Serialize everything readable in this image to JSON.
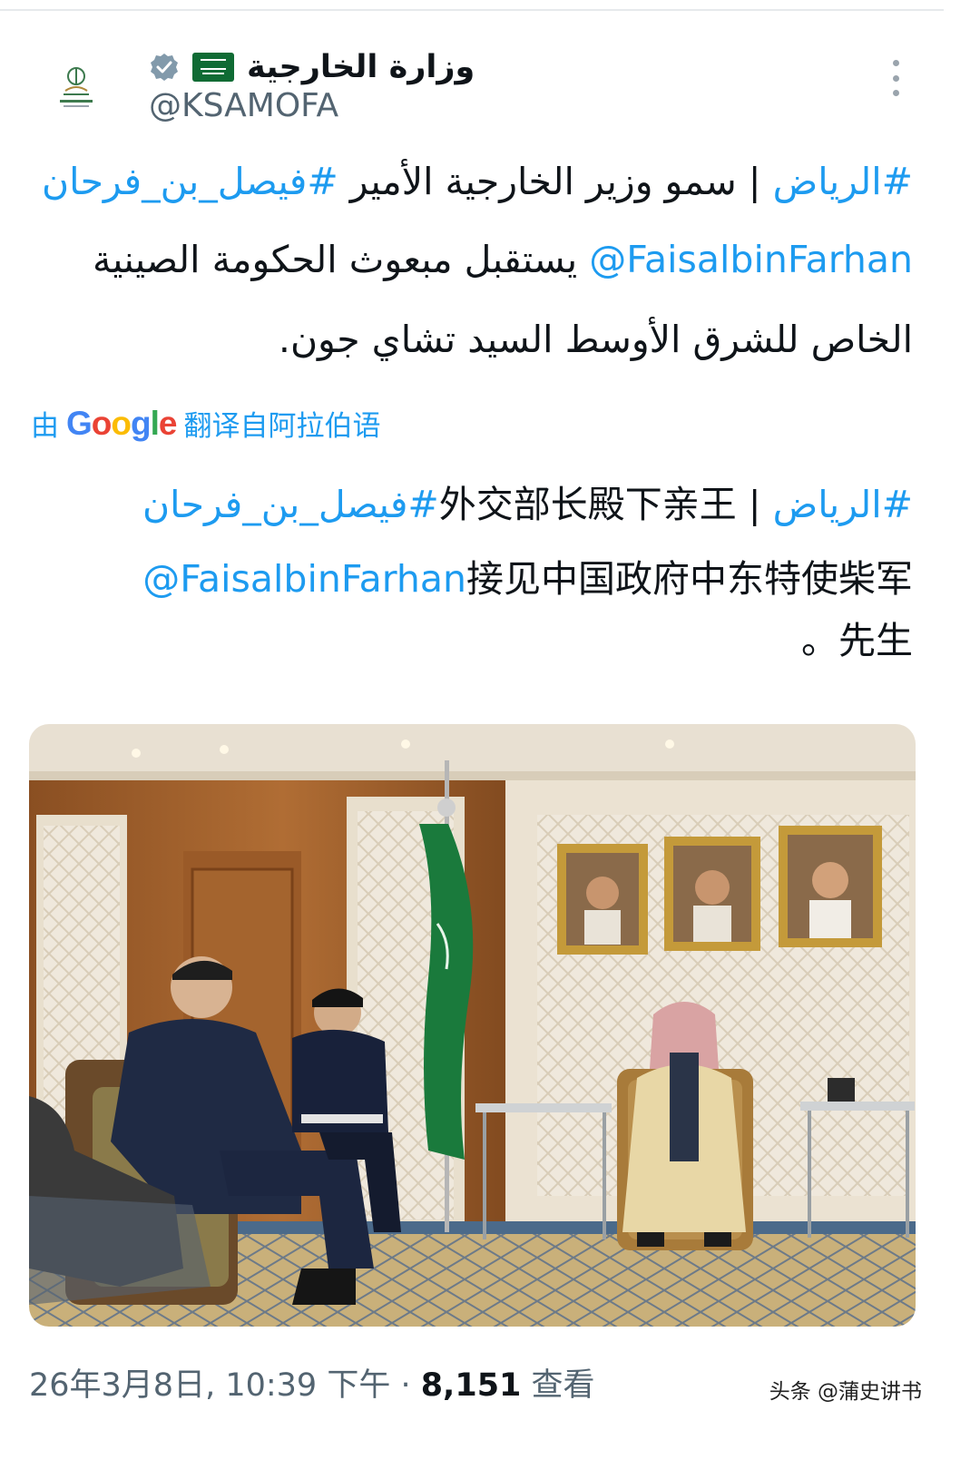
{
  "account": {
    "display_name": "وزارة الخارجية",
    "handle": "@KSAMOFA",
    "verified_icon": "verified-badge-icon",
    "flag_icon": "saudi-flag-icon"
  },
  "tweet_original": {
    "line1_hashtag1": "#الرياض",
    "line1_text": " | سمو وزير الخارجية الأمير ",
    "line1_hashtag2": "#فيصل_بن_فرحان",
    "line2_mention": "@FaisalbinFarhan",
    "line2_text": " يستقبل مبعوث الحكومة الصينية",
    "line3_text": "الخاص للشرق الأوسط السيد تشاي جون."
  },
  "translation_label": {
    "prefix": "由",
    "brand": [
      "G",
      "o",
      "o",
      "g",
      "l",
      "e"
    ],
    "suffix": "翻译自阿拉伯语"
  },
  "tweet_translated": {
    "line1_hashtag1": "#الرياض",
    "line1_sep": " | ",
    "line1_text": "外交部长殿下亲王",
    "line1_hashtag2": "#فيصل_بن_فرحان",
    "line2_mention": "@FaisalbinFarhan",
    "line2_text": "接见中国政府中东特使柴军",
    "line3_text": "。先生"
  },
  "footer": {
    "timestamp": "26年3月8日, 10:39 下午 · ",
    "views_count": "8,151",
    "views_label": " 查看"
  },
  "watermark": "头条 @蒲史讲书",
  "colors": {
    "link": "#1d9bf0",
    "text": "#0f1419",
    "secondary": "#536471",
    "flag_green": "#0f6b34"
  }
}
